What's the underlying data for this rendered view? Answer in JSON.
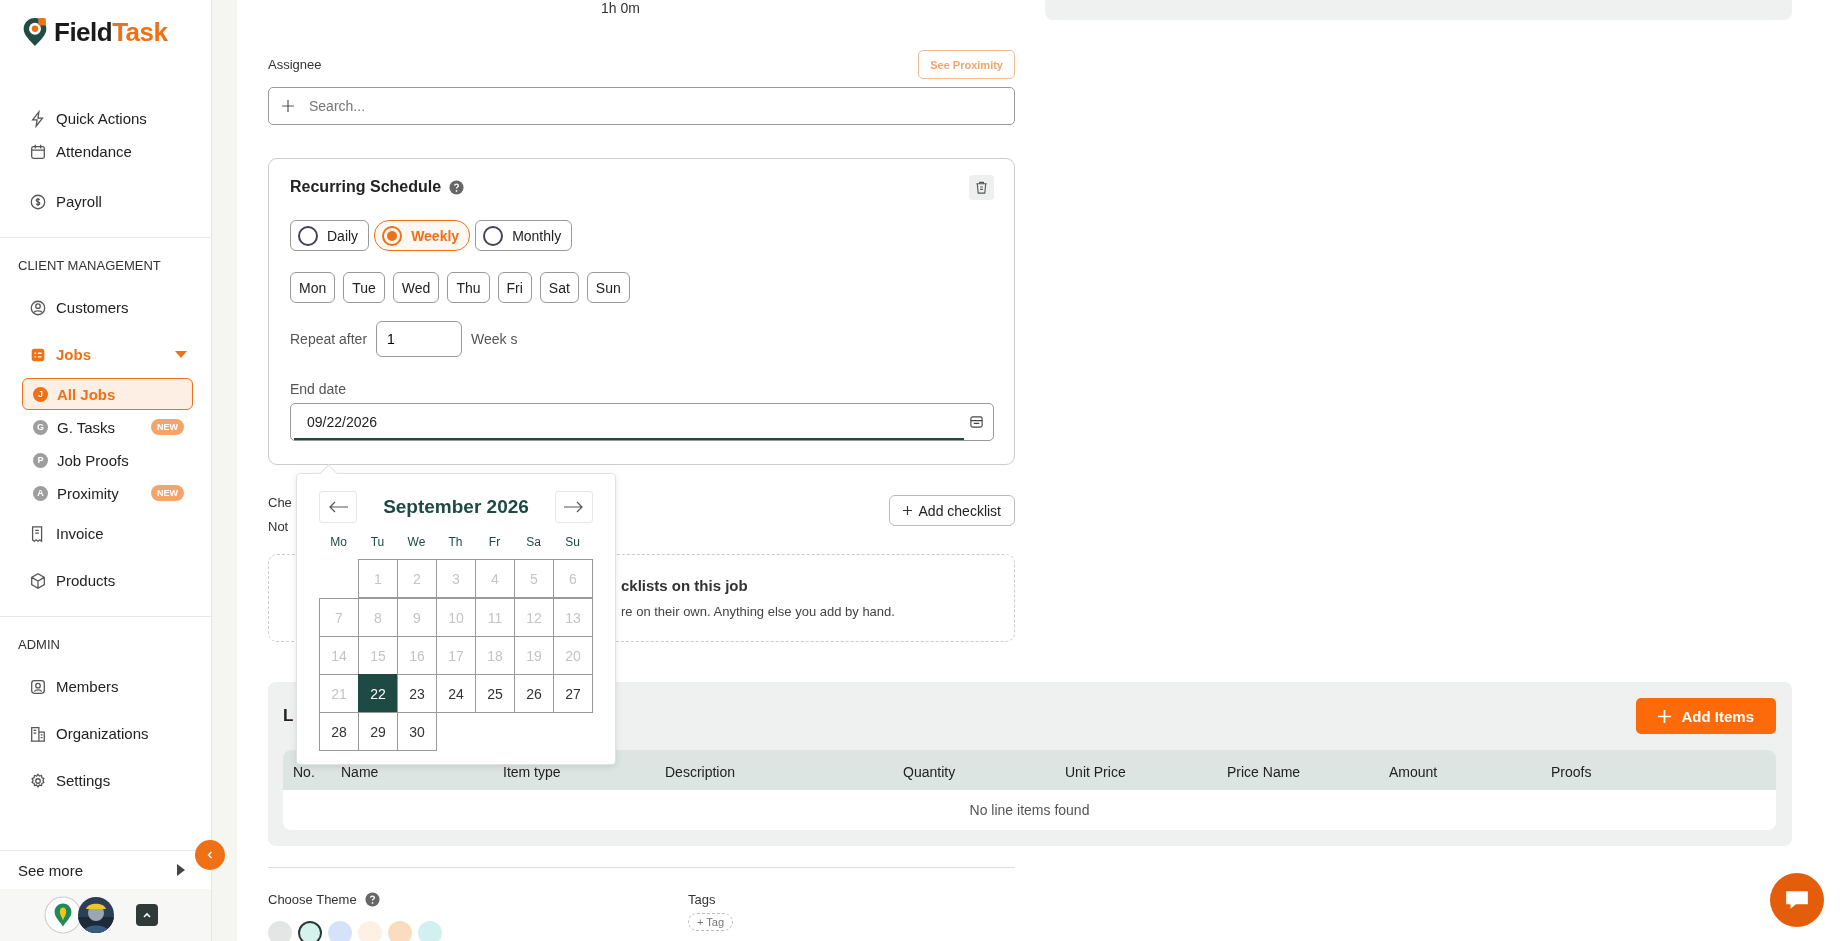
{
  "brand": {
    "first": "Field",
    "second": "Task"
  },
  "sidebar": {
    "sections": [
      {
        "items": [
          {
            "label": "Quick Actions",
            "kind": "nav"
          },
          {
            "label": "Attendance",
            "kind": "nav"
          },
          {
            "label": "Payroll",
            "kind": "nav"
          }
        ]
      },
      {
        "heading": "CLIENT MANAGEMENT",
        "items": [
          {
            "label": "Customers",
            "kind": "nav"
          },
          {
            "label": "Jobs",
            "kind": "group",
            "expanded": true,
            "children": [
              {
                "label": "All Jobs",
                "initial": "J",
                "selected": true
              },
              {
                "label": "G. Tasks",
                "initial": "G",
                "selected": false,
                "badge": "NEW"
              },
              {
                "label": "Job Proofs",
                "initial": "P",
                "selected": false
              },
              {
                "label": "Proximity",
                "initial": "A",
                "selected": false,
                "badge": "NEW"
              }
            ]
          },
          {
            "label": "Invoice",
            "kind": "nav"
          },
          {
            "label": "Products",
            "kind": "nav"
          }
        ]
      },
      {
        "heading": "ADMIN",
        "items": [
          {
            "label": "Members",
            "kind": "nav"
          },
          {
            "label": "Organizations",
            "kind": "nav"
          },
          {
            "label": "Settings",
            "kind": "nav"
          }
        ]
      }
    ],
    "see_more": "See more"
  },
  "duration": "1h 0m",
  "assignee": {
    "label": "Assignee",
    "proximity_button": "See Proximity",
    "placeholder": "Search..."
  },
  "schedule": {
    "title": "Recurring Schedule",
    "frequencies": [
      {
        "label": "Daily",
        "selected": false
      },
      {
        "label": "Weekly",
        "selected": true
      },
      {
        "label": "Monthly",
        "selected": false
      }
    ],
    "weekdays": [
      "Mon",
      "Tue",
      "Wed",
      "Thu",
      "Fri",
      "Sat",
      "Sun"
    ],
    "repeat_label": "Repeat after",
    "repeat_value": "1",
    "repeat_unit": "Week s",
    "end_date_label": "End date",
    "end_date": "09/22/2026"
  },
  "datepicker": {
    "month": "September 2026",
    "weekday_headers": [
      "Mo",
      "Tu",
      "We",
      "Th",
      "Fr",
      "Sa",
      "Su"
    ],
    "weeks": [
      [
        {
          "label": "1",
          "disabled": true,
          "selected": false
        },
        {
          "label": "2",
          "disabled": true,
          "selected": false
        },
        {
          "label": "3",
          "disabled": true,
          "selected": false
        },
        {
          "label": "4",
          "disabled": true,
          "selected": false
        },
        {
          "label": "5",
          "disabled": true,
          "selected": false
        },
        {
          "label": "6",
          "disabled": true,
          "selected": false
        }
      ],
      [
        {
          "label": "7",
          "disabled": true,
          "selected": false
        },
        {
          "label": "8",
          "disabled": true,
          "selected": false
        },
        {
          "label": "9",
          "disabled": true,
          "selected": false
        },
        {
          "label": "10",
          "disabled": true,
          "selected": false
        },
        {
          "label": "11",
          "disabled": true,
          "selected": false
        },
        {
          "label": "12",
          "disabled": true,
          "selected": false
        },
        {
          "label": "13",
          "disabled": true,
          "selected": false
        }
      ],
      [
        {
          "label": "14",
          "disabled": true,
          "selected": false
        },
        {
          "label": "15",
          "disabled": true,
          "selected": false
        },
        {
          "label": "16",
          "disabled": true,
          "selected": false
        },
        {
          "label": "17",
          "disabled": true,
          "selected": false
        },
        {
          "label": "18",
          "disabled": true,
          "selected": false
        },
        {
          "label": "19",
          "disabled": true,
          "selected": false
        },
        {
          "label": "20",
          "disabled": true,
          "selected": false
        }
      ],
      [
        {
          "label": "21",
          "disabled": true,
          "selected": false
        },
        {
          "label": "22",
          "disabled": false,
          "selected": true
        },
        {
          "label": "23",
          "disabled": false,
          "selected": false
        },
        {
          "label": "24",
          "disabled": false,
          "selected": false
        },
        {
          "label": "25",
          "disabled": false,
          "selected": false
        },
        {
          "label": "26",
          "disabled": false,
          "selected": false
        },
        {
          "label": "27",
          "disabled": false,
          "selected": false
        }
      ],
      [
        {
          "label": "28",
          "disabled": false,
          "selected": false
        },
        {
          "label": "29",
          "disabled": false,
          "selected": false
        },
        {
          "label": "30",
          "disabled": false,
          "selected": false
        }
      ]
    ]
  },
  "checklists": {
    "label": "Che",
    "note": "Not",
    "add_button": "Add checklist",
    "empty_title": "cklists on this job",
    "empty_text": "re on their own. Anything else you add by hand."
  },
  "line_items": {
    "title": "L",
    "add_button": "Add Items",
    "columns": [
      "No.",
      "Name",
      "Item type",
      "Description",
      "Quantity",
      "Unit Price",
      "Price Name",
      "Amount",
      "Proofs"
    ],
    "empty": "No line items found"
  },
  "theme": {
    "label": "Choose Theme",
    "swatches": [
      {
        "color": "#e4e6e6",
        "selected": false
      },
      {
        "color": "#d5f2ec",
        "selected": true
      },
      {
        "color": "#d6e2fa",
        "selected": false
      },
      {
        "color": "#fdf1e3",
        "selected": false
      },
      {
        "color": "#fcdcbf",
        "selected": false
      },
      {
        "color": "#d2f0ef",
        "selected": false
      }
    ]
  },
  "tags": {
    "label": "Tags",
    "add": "+ Tag"
  }
}
